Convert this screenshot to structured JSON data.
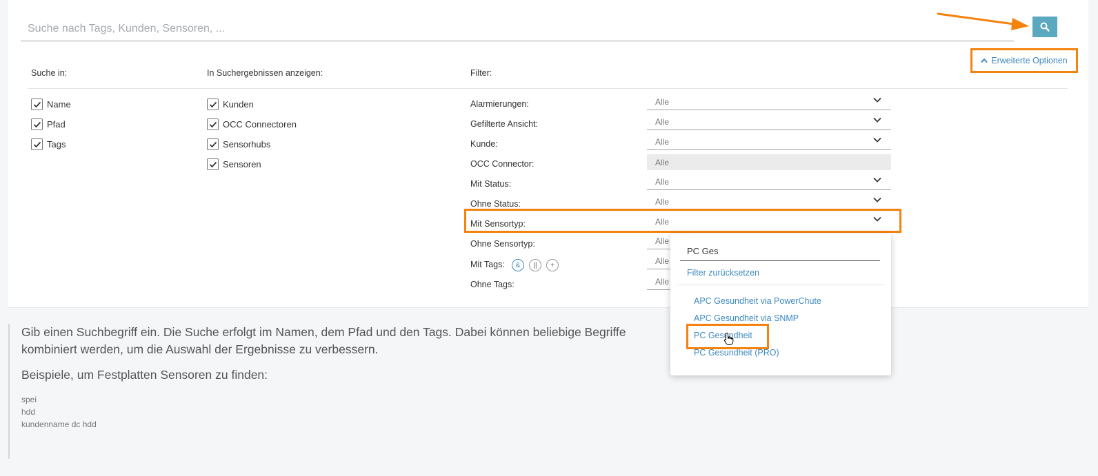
{
  "search": {
    "placeholder": "Suche nach Tags, Kunden, Sensoren, ..."
  },
  "advanced_options_label": "Erweiterte Optionen",
  "columns": {
    "search_in": "Suche in:",
    "show_in_results": "In Suchergebnissen anzeigen:",
    "filter": "Filter:"
  },
  "search_in_items": [
    {
      "label": "Name",
      "checked": true
    },
    {
      "label": "Pfad",
      "checked": true
    },
    {
      "label": "Tags",
      "checked": true
    }
  ],
  "result_items": [
    {
      "label": "Kunden",
      "checked": true
    },
    {
      "label": "OCC Connectoren",
      "checked": true
    },
    {
      "label": "Sensorhubs",
      "checked": true
    },
    {
      "label": "Sensoren",
      "checked": true
    }
  ],
  "filters": [
    {
      "label": "Alarmierungen:",
      "value": "Alle"
    },
    {
      "label": "Gefilterte Ansicht:",
      "value": "Alle"
    },
    {
      "label": "Kunde:",
      "value": "Alle"
    },
    {
      "label": "OCC Connector:",
      "value": "Alle"
    },
    {
      "label": "Mit Status:",
      "value": "Alle"
    },
    {
      "label": "Ohne Status:",
      "value": "Alle"
    },
    {
      "label": "Mit Sensortyp:",
      "value": "Alle"
    },
    {
      "label": "Ohne Sensortyp:",
      "value": "Alle"
    },
    {
      "label": "Mit Tags:",
      "value": "Alle"
    },
    {
      "label": "Ohne Tags:",
      "value": "Alle"
    }
  ],
  "tag_operators": [
    "&",
    "||",
    "+"
  ],
  "dropdown": {
    "search_value": "PC Ges",
    "reset_label": "Filter zurücksetzen",
    "options": [
      "APC Gesundheit via PowerChute",
      "APC Gesundheit via SNMP",
      "PC Gesundheit",
      "PC Gesundheit (PRO)"
    ]
  },
  "help": {
    "intro": "Gib einen Suchbegriff ein. Die Suche erfolgt im Namen, dem Pfad und den Tags. Dabei können beliebige Begriffe kombiniert werden, um die Auswahl der Ergebnisse zu verbessern.",
    "examples_title": "Beispiele, um Festplatten Sensoren zu finden:",
    "examples": [
      "spei",
      "hdd",
      "kundenname dc hdd"
    ]
  },
  "colors": {
    "accent": "#3c89bf",
    "search_button": "#5ba8c1",
    "highlight": "#f5820d"
  }
}
